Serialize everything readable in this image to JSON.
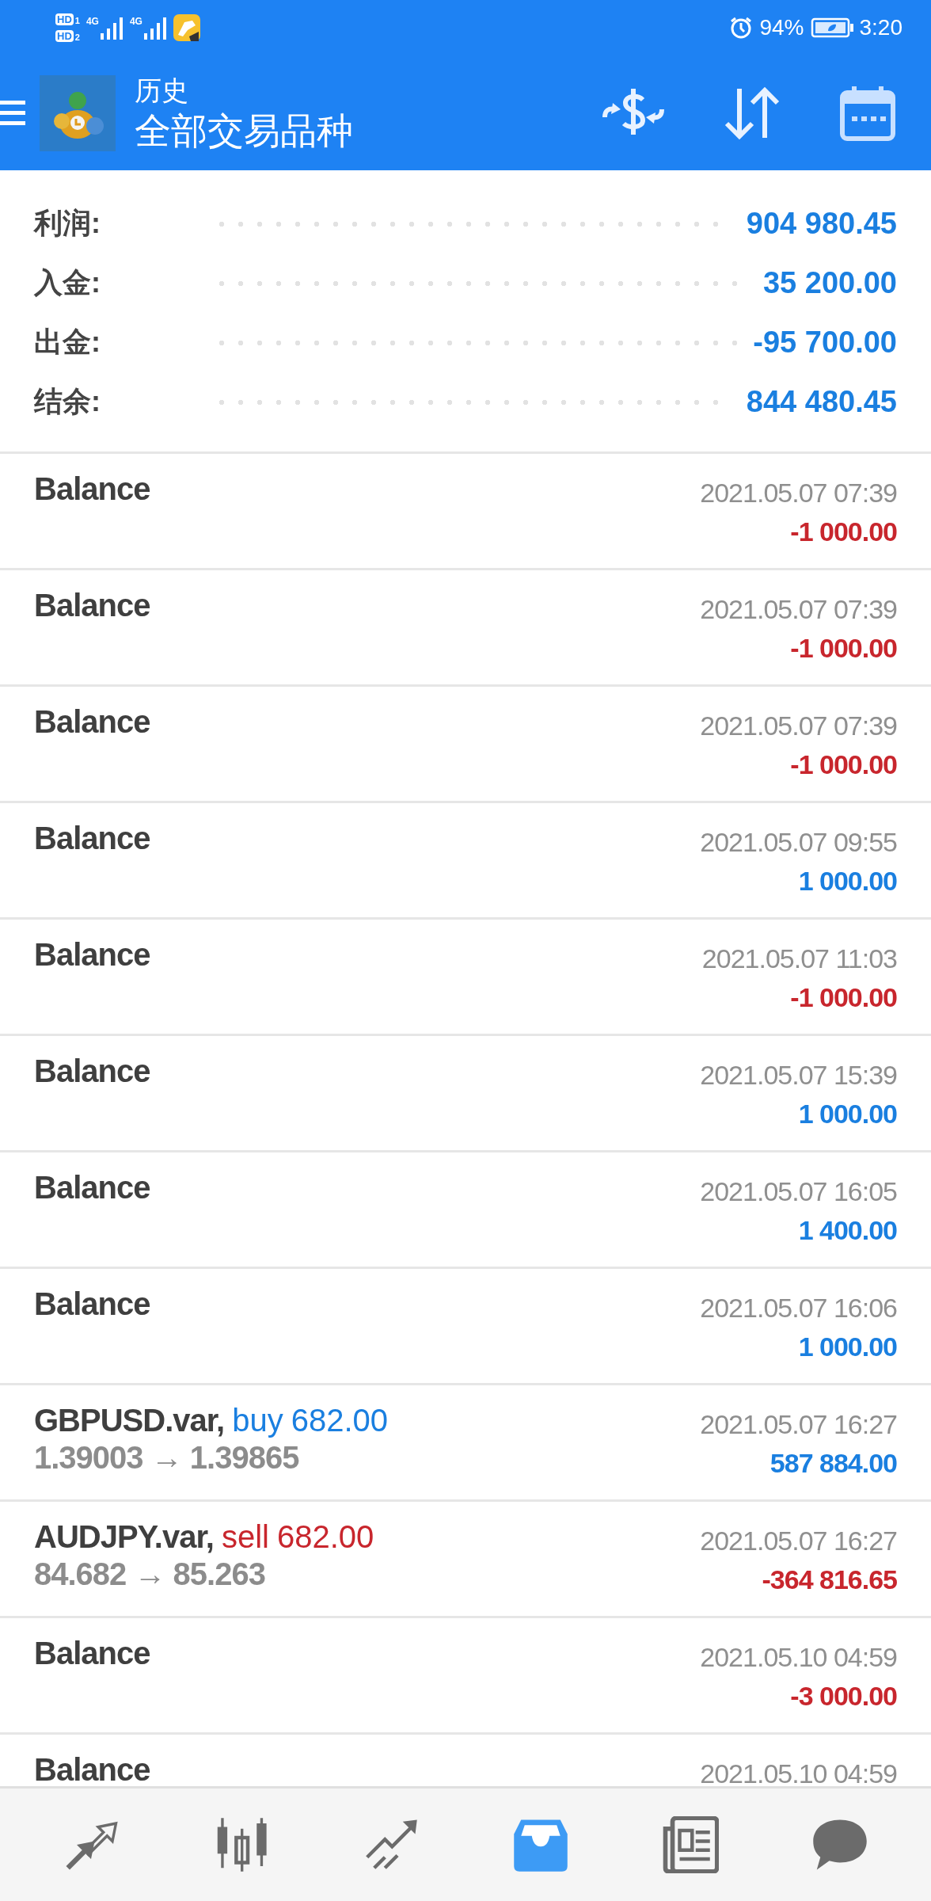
{
  "status_bar": {
    "sims": [
      {
        "badge": "HD",
        "slot": "1",
        "network": "4G"
      },
      {
        "badge": "HD",
        "slot": "2",
        "network": "4G"
      }
    ],
    "battery": "94%",
    "time": "3:20"
  },
  "header": {
    "title": "历史",
    "subtitle": "全部交易品种"
  },
  "summary": [
    {
      "label": "利润:",
      "value": "904 980.45"
    },
    {
      "label": "入金:",
      "value": "35 200.00"
    },
    {
      "label": "出金:",
      "value": "-95 700.00"
    },
    {
      "label": "结余:",
      "value": "844 480.45"
    }
  ],
  "rows": [
    {
      "kind": "balance",
      "title": "Balance",
      "time": "2021.05.07 07:39",
      "amount": "-1 000.00",
      "color": "#c8262d"
    },
    {
      "kind": "balance",
      "title": "Balance",
      "time": "2021.05.07 07:39",
      "amount": "-1 000.00",
      "color": "#c8262d"
    },
    {
      "kind": "balance",
      "title": "Balance",
      "time": "2021.05.07 07:39",
      "amount": "-1 000.00",
      "color": "#c8262d"
    },
    {
      "kind": "balance",
      "title": "Balance",
      "time": "2021.05.07 09:55",
      "amount": "1 000.00",
      "color": "#1a7fe0"
    },
    {
      "kind": "balance",
      "title": "Balance",
      "time": "2021.05.07 11:03",
      "amount": "-1 000.00",
      "color": "#c8262d"
    },
    {
      "kind": "balance",
      "title": "Balance",
      "time": "2021.05.07 15:39",
      "amount": "1 000.00",
      "color": "#1a7fe0"
    },
    {
      "kind": "balance",
      "title": "Balance",
      "time": "2021.05.07 16:05",
      "amount": "1 400.00",
      "color": "#1a7fe0"
    },
    {
      "kind": "balance",
      "title": "Balance",
      "time": "2021.05.07 16:06",
      "amount": "1 000.00",
      "color": "#1a7fe0"
    },
    {
      "kind": "trade",
      "title": "GBPUSD.var,",
      "side": "buy",
      "volume": "682.00",
      "prices": "1.39003 → 1.39865",
      "time": "2021.05.07 16:27",
      "amount": "587 884.00",
      "color": "#1a7fe0"
    },
    {
      "kind": "trade",
      "title": "AUDJPY.var,",
      "side": "sell",
      "volume": "682.00",
      "prices": "84.682 → 85.263",
      "time": "2021.05.07 16:27",
      "amount": "-364 816.65",
      "color": "#c8262d"
    },
    {
      "kind": "balance",
      "title": "Balance",
      "time": "2021.05.10 04:59",
      "amount": "-3 000.00",
      "color": "#c8262d"
    },
    {
      "kind": "balance",
      "title": "Balance",
      "time": "2021.05.10 04:59"
    }
  ],
  "bottom_nav": [
    {
      "kind": "quotes",
      "selected": false
    },
    {
      "kind": "chart",
      "selected": false
    },
    {
      "kind": "trade",
      "selected": false
    },
    {
      "kind": "history",
      "selected": true
    },
    {
      "kind": "news",
      "selected": false
    },
    {
      "kind": "chat",
      "selected": false
    }
  ]
}
